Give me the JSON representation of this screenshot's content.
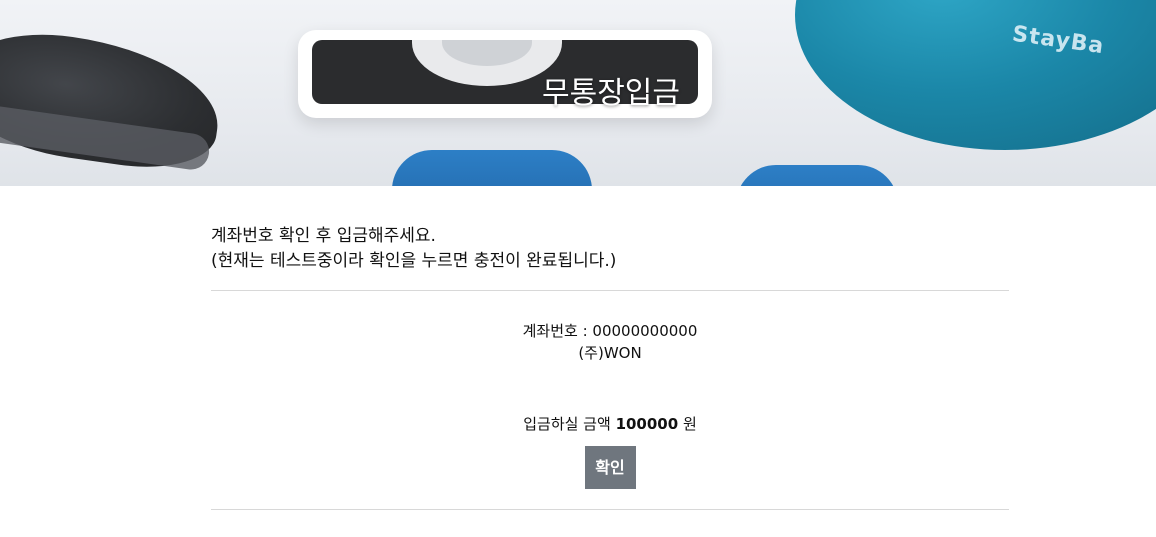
{
  "hero": {
    "title": "무통장입금",
    "ball_brand": "StayBa"
  },
  "notice": {
    "line1": "계좌번호 확인 후 입금해주세요.",
    "line2": "(현재는 테스트중이라 확인을 누르면 충전이 완료됩니다.)"
  },
  "account": {
    "label": "계좌번호 : ",
    "number": "00000000000",
    "holder": "(주)WON"
  },
  "amount": {
    "label": "입금하실 금액 ",
    "value": "100000",
    "unit": " 원"
  },
  "confirm_label": "확인",
  "colors": {
    "button_bg": "#6f767e",
    "divider": "#d8d8d8"
  }
}
